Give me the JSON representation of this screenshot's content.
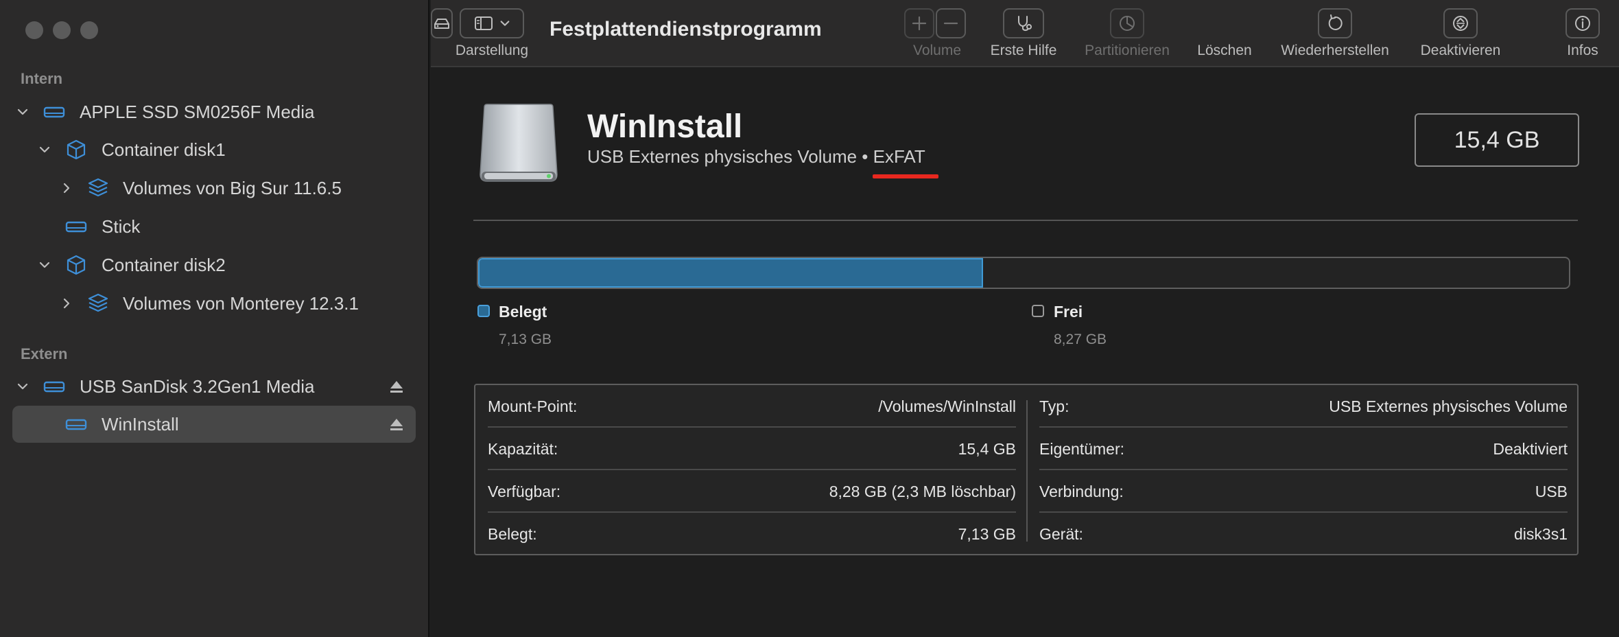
{
  "sidebar": {
    "section_intern": "Intern",
    "section_extern": "Extern",
    "items": [
      {
        "label": "APPLE SSD SM0256F Media",
        "icon": "internal-disk-icon"
      },
      {
        "label": "Container disk1",
        "icon": "container-icon"
      },
      {
        "label": "Volumes von Big Sur 11.6.5",
        "icon": "volume-stack-icon"
      },
      {
        "label": "Stick",
        "icon": "disk-icon"
      },
      {
        "label": "Container disk2",
        "icon": "container-icon"
      },
      {
        "label": "Volumes von Monterey 12.3.1",
        "icon": "volume-stack-icon"
      },
      {
        "label": "USB SanDisk 3.2Gen1 Media",
        "icon": "external-disk-icon"
      },
      {
        "label": "WinInstall",
        "icon": "disk-icon",
        "selected": true
      }
    ]
  },
  "toolbar": {
    "title": "Festplattendienstprogramm",
    "darstellung": "Darstellung",
    "volume": "Volume",
    "erste_hilfe": "Erste Hilfe",
    "partitionieren": "Partitionieren",
    "loeschen": "Löschen",
    "wiederherstellen": "Wiederherstellen",
    "deaktivieren": "Deaktivieren",
    "infos": "Infos"
  },
  "volume": {
    "name": "WinInstall",
    "subtitle": "USB Externes physisches Volume • ExFAT",
    "size": "15,4 GB"
  },
  "usage": {
    "used_fraction": 0.463,
    "used_label": "Belegt",
    "used_value": "7,13 GB",
    "free_label": "Frei",
    "free_value": "8,27 GB",
    "used_color": "#2a6a94"
  },
  "info": {
    "left": [
      {
        "key": "Mount-Point:",
        "value": "/Volumes/WinInstall"
      },
      {
        "key": "Kapazität:",
        "value": "15,4 GB"
      },
      {
        "key": "Verfügbar:",
        "value": "8,28 GB (2,3 MB löschbar)"
      },
      {
        "key": "Belegt:",
        "value": "7,13 GB"
      }
    ],
    "right": [
      {
        "key": "Typ:",
        "value": "USB Externes physisches Volume"
      },
      {
        "key": "Eigentümer:",
        "value": "Deaktiviert"
      },
      {
        "key": "Verbindung:",
        "value": "USB"
      },
      {
        "key": "Gerät:",
        "value": "disk3s1"
      }
    ]
  }
}
